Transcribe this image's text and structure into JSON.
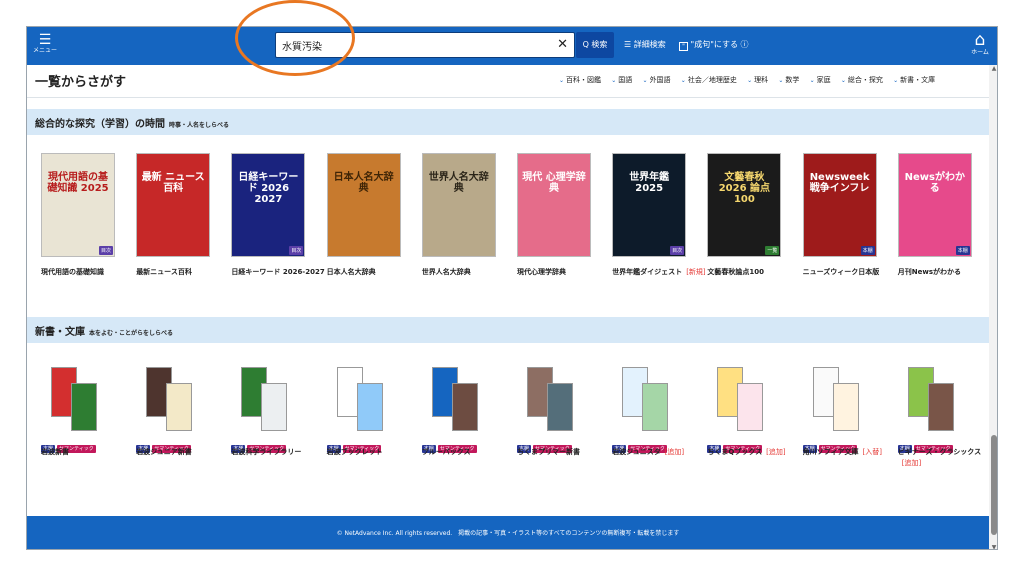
{
  "topbar": {
    "menu_label": "メニュー",
    "search_value": "水質汚染",
    "search_button": "Q 検索",
    "advanced_search": "詳細検索",
    "seiku_label": "\"成句\"にする ⓘ",
    "home_label": "ホーム"
  },
  "browse": {
    "title": "一覧からさがす",
    "categories": [
      "百科・図鑑",
      "国語",
      "外国語",
      "社会／地理歴史",
      "理科",
      "数学",
      "家庭",
      "総合・探究",
      "新書・文庫"
    ]
  },
  "sections": [
    {
      "title": "総合的な探究（学習）の時間",
      "subtitle": "時事・人名をしらべる",
      "books": [
        {
          "name": "現代用語の基礎知識",
          "tag": "",
          "badges": [
            "目次"
          ],
          "cover_text": "現代用語の基礎知識 2025",
          "cover_color": "#e9e4d4",
          "text_color": "#b71c1c"
        },
        {
          "name": "最新ニュース百科",
          "tag": "",
          "badges": [],
          "cover_text": "最新 ニュース百科",
          "cover_color": "#c62828",
          "text_color": "#ffffff"
        },
        {
          "name": "日経キーワード 2026-2027",
          "tag": "",
          "badges": [
            "目次"
          ],
          "cover_text": "日経キーワード 2026 2027",
          "cover_color": "#1a237e",
          "text_color": "#ffffff"
        },
        {
          "name": "日本人名大辞典",
          "tag": "",
          "badges": [],
          "cover_text": "日本人名大辞典",
          "cover_color": "#c77a2e",
          "text_color": "#3e2406"
        },
        {
          "name": "世界人名大辞典",
          "tag": "",
          "badges": [],
          "cover_text": "世界人名大辞典",
          "cover_color": "#b8a98a",
          "text_color": "#2a2418"
        },
        {
          "name": "現代心理学辞典",
          "tag": "",
          "badges": [],
          "cover_text": "現代 心理学辞典",
          "cover_color": "#e56c8a",
          "text_color": "#ffffff"
        },
        {
          "name": "世界年鑑ダイジェスト",
          "tag": "[新規]",
          "badges": [
            "目次"
          ],
          "cover_text": "世界年鑑 2025",
          "cover_color": "#0d1b2a",
          "text_color": "#ffffff"
        },
        {
          "name": "文藝春秋論点100",
          "tag": "",
          "badges": [
            "一覧"
          ],
          "cover_text": "文藝春秋 2026 論点 100",
          "cover_color": "#1b1b1b",
          "text_color": "#f5d76e"
        },
        {
          "name": "ニューズウィーク日本版",
          "tag": "",
          "badges": [
            "本棚"
          ],
          "cover_text": "Newsweek 戦争インフレ",
          "cover_color": "#9e1b1b",
          "text_color": "#ffffff"
        },
        {
          "name": "月刊Newsがわかる",
          "tag": "",
          "badges": [
            "本棚"
          ],
          "cover_text": "Newsがわかる",
          "cover_color": "#e64a8b",
          "text_color": "#ffffff"
        }
      ]
    },
    {
      "title": "新書・文庫",
      "subtitle": "本をよむ・ことがらをしらべる",
      "books": [
        {
          "name": "岩波新書",
          "tag": "",
          "badges": [
            "本棚",
            "セマンティック"
          ],
          "colors": [
            "#d32f2f",
            "#2e7d32"
          ]
        },
        {
          "name": "岩波ジュニア新書",
          "tag": "",
          "badges": [
            "本棚",
            "セマンティック"
          ],
          "colors": [
            "#4e342e",
            "#f3e9c8"
          ]
        },
        {
          "name": "岩波科学ライブラリー",
          "tag": "",
          "badges": [
            "本棚",
            "セマンティック"
          ],
          "colors": [
            "#2e7d32",
            "#eceff1"
          ]
        },
        {
          "name": "岩波ブックレット",
          "tag": "",
          "badges": [
            "本棚",
            "セマンティック"
          ],
          "colors": [
            "#ffffff",
            "#90caf9"
          ]
        },
        {
          "name": "ブルーバックス",
          "tag": "",
          "badges": [
            "本棚",
            "セマンティック"
          ],
          "colors": [
            "#1565c0",
            "#6d4c41"
          ]
        },
        {
          "name": "ちくまプリマー新書",
          "tag": "",
          "badges": [
            "本棚",
            "セマンティック"
          ],
          "colors": [
            "#8d6e63",
            "#546e7a"
          ]
        },
        {
          "name": "岩波ジュニスタ",
          "tag": "[追加]",
          "badges": [
            "本棚",
            "セマンティック"
          ],
          "colors": [
            "#e3f2fd",
            "#a5d6a7"
          ]
        },
        {
          "name": "ちくまQブックス",
          "tag": "[追加]",
          "badges": [
            "本棚",
            "セマンティック"
          ],
          "colors": [
            "#ffe082",
            "#fce4ec"
          ]
        },
        {
          "name": "角川ソフィア文庫",
          "tag": "[入替]",
          "badges": [
            "本棚",
            "セマンティック"
          ],
          "colors": [
            "#fafafa",
            "#fff3e0"
          ]
        },
        {
          "name": "ビギナーズ・クラシックス",
          "tag": "[追加]",
          "badges": [
            "本棚",
            "セマンティック"
          ],
          "colors": [
            "#8bc34a",
            "#795548"
          ]
        }
      ]
    }
  ],
  "footer": "© NetAdvance Inc. All rights reserved.　掲載の記事・写真・イラスト等のすべてのコンテンツの無断複写・転載を禁じます",
  "colors": {
    "primary": "#1565c0",
    "band": "#d6e8f7",
    "annotation": "#e87722"
  }
}
